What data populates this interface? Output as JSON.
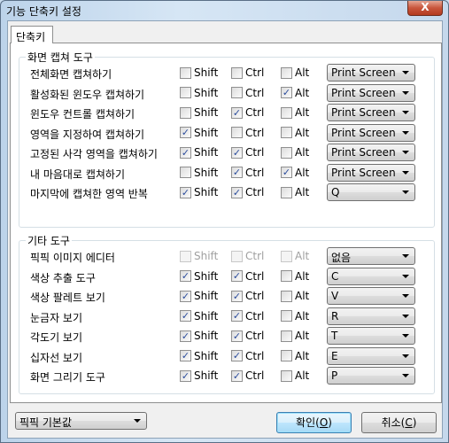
{
  "window": {
    "title": "기능 단축키 설정",
    "close_label": "X"
  },
  "tab": {
    "label": "단축키"
  },
  "modifiers": {
    "shift": "Shift",
    "ctrl": "Ctrl",
    "alt": "Alt"
  },
  "groups": [
    {
      "title": "화면 캡쳐 도구",
      "rows": [
        {
          "label": "전체화면 캡쳐하기",
          "shift": false,
          "ctrl": false,
          "alt": false,
          "key": "Print Screen"
        },
        {
          "label": "활성화된 윈도우 캡쳐하기",
          "shift": false,
          "ctrl": false,
          "alt": true,
          "key": "Print Screen"
        },
        {
          "label": "윈도우 컨트롤 캡쳐하기",
          "shift": false,
          "ctrl": true,
          "alt": false,
          "key": "Print Screen"
        },
        {
          "label": "영역을 지정하여 캡쳐하기",
          "shift": true,
          "ctrl": false,
          "alt": false,
          "key": "Print Screen"
        },
        {
          "label": "고정된 사각 영역을 캡쳐하기",
          "shift": true,
          "ctrl": true,
          "alt": false,
          "key": "Print Screen"
        },
        {
          "label": "내 마음대로 캡쳐하기",
          "shift": false,
          "ctrl": true,
          "alt": true,
          "key": "Print Screen"
        },
        {
          "label": "마지막에 캡쳐한 영역 반복",
          "shift": true,
          "ctrl": true,
          "alt": false,
          "key": "Q"
        }
      ]
    },
    {
      "title": "기타 도구",
      "rows": [
        {
          "label": "픽픽 이미지 에디터",
          "shift": false,
          "ctrl": false,
          "alt": false,
          "disabled": true,
          "key": "없음"
        },
        {
          "label": "색상 추출 도구",
          "shift": true,
          "ctrl": true,
          "alt": false,
          "key": "C"
        },
        {
          "label": "색상 팔레트 보기",
          "shift": true,
          "ctrl": true,
          "alt": false,
          "key": "V"
        },
        {
          "label": "눈금자 보기",
          "shift": true,
          "ctrl": true,
          "alt": false,
          "key": "R"
        },
        {
          "label": "각도기 보기",
          "shift": true,
          "ctrl": true,
          "alt": false,
          "key": "T"
        },
        {
          "label": "십자선 보기",
          "shift": true,
          "ctrl": true,
          "alt": false,
          "key": "E"
        },
        {
          "label": "화면 그리기 도구",
          "shift": true,
          "ctrl": true,
          "alt": false,
          "key": "P"
        }
      ]
    }
  ],
  "footer": {
    "preset": "픽픽 기본값",
    "ok_label": "확인(",
    "ok_key": "O",
    "ok_end": ")",
    "cancel_label": "취소(",
    "cancel_key": "C",
    "cancel_end": ")"
  }
}
